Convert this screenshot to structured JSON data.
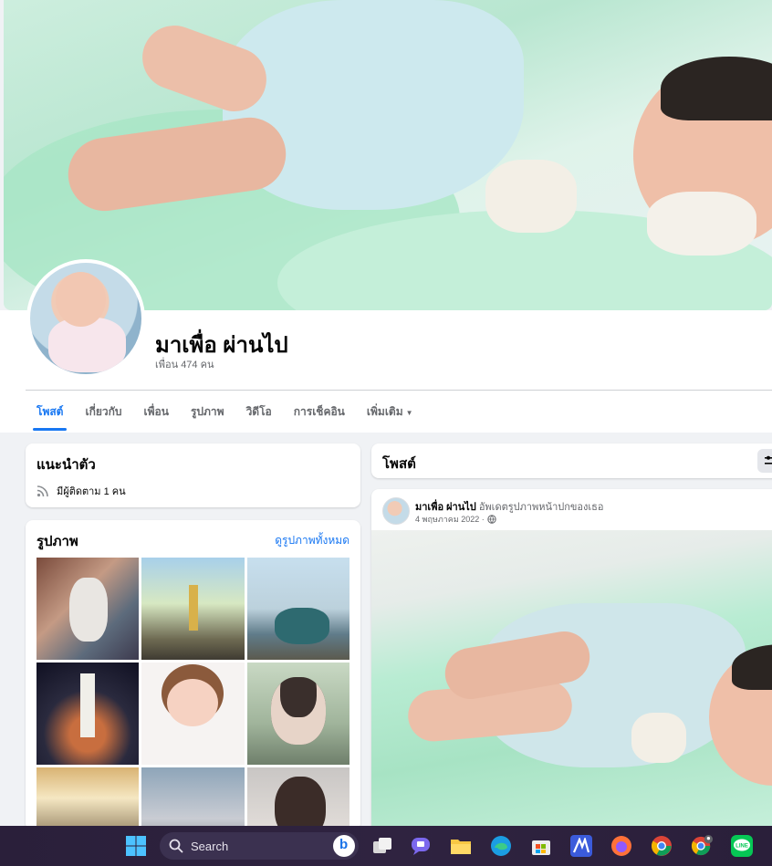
{
  "profile": {
    "name": "มาเพื่อ ผ่านไป",
    "friends": "เพื่อน 474 คน"
  },
  "tabs": [
    {
      "label": "โพสต์",
      "active": true
    },
    {
      "label": "เกี่ยวกับ",
      "active": false
    },
    {
      "label": "เพื่อน",
      "active": false
    },
    {
      "label": "รูปภาพ",
      "active": false
    },
    {
      "label": "วิดีโอ",
      "active": false
    },
    {
      "label": "การเช็คอิน",
      "active": false
    },
    {
      "label": "เพิ่มเติม",
      "active": false
    }
  ],
  "intro": {
    "title": "แนะนำตัว",
    "followers": "มีผู้ติดตาม 1 คน"
  },
  "photos": {
    "title": "รูปภาพ",
    "see_all": "ดูรูปภาพทั้งหมด"
  },
  "posts": {
    "title": "โพสต์",
    "post": {
      "author": "มาเพื่อ ผ่านไป",
      "action": "อัพเดตรูปภาพหน้าปกของเธอ",
      "date": "4 พฤษภาคม 2022 ·"
    }
  },
  "taskbar": {
    "search_label": "Search"
  },
  "colors": {
    "accent": "#1877f2",
    "background": "#f0f2f5",
    "taskbar": "#2a1f3a"
  }
}
